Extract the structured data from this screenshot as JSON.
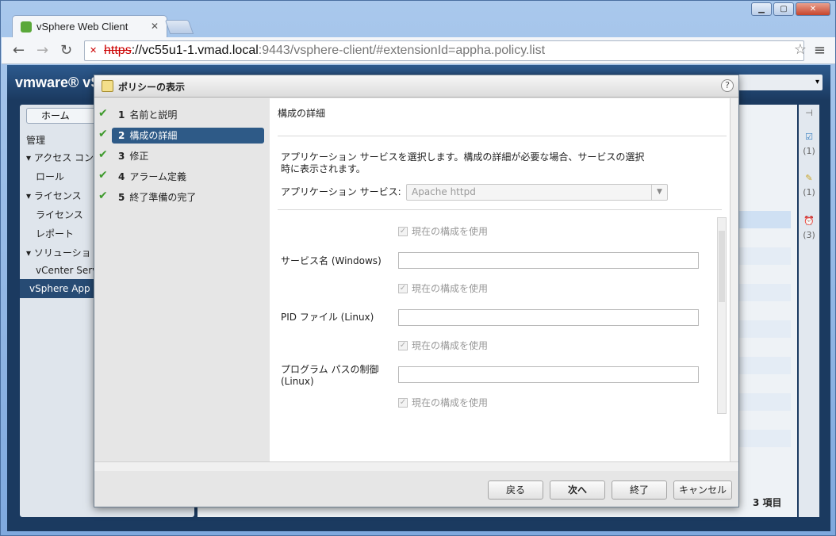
{
  "browser": {
    "tab_title": "vSphere Web Client",
    "url_scheme": "https",
    "url_host": "://vc55u1-1.vmad.local",
    "url_path": ":9443/vsphere-client/#extensionId=appha.policy.list"
  },
  "app": {
    "logo": "vmware® vS",
    "nav": {
      "home_label": "ホーム",
      "items": [
        "管理",
        "▾ アクセス コン",
        "ロール",
        "▾ ライセンス",
        "ライセンス",
        "レポート",
        "▾ ソリューショ",
        "vCenter Serve",
        "vSphere App H"
      ]
    },
    "items_count": "3 項目",
    "side_counts": [
      "(1)",
      "(1)",
      "(3)"
    ]
  },
  "dialog": {
    "title": "ポリシーの表示",
    "steps": [
      {
        "num": "1",
        "label": "名前と説明"
      },
      {
        "num": "2",
        "label": "構成の詳細"
      },
      {
        "num": "3",
        "label": "修正"
      },
      {
        "num": "4",
        "label": "アラーム定義"
      },
      {
        "num": "5",
        "label": "終了準備の完了"
      }
    ],
    "section_title": "構成の詳細",
    "description": "アプリケーション サービスを選択します。構成の詳細が必要な場合、サービスの選択時に表示されます。",
    "app_service_label": "アプリケーション サービス:",
    "app_service_value": "Apache httpd",
    "use_current_config": "現在の構成を使用",
    "service_name_label": "サービス名 (Windows)",
    "pid_file_label": "PID ファイル (Linux)",
    "program_path_label": "プログラム パスの制御 (Linux)",
    "buttons": {
      "back": "戻る",
      "next": "次へ",
      "finish": "終了",
      "cancel": "キャンセル"
    }
  }
}
